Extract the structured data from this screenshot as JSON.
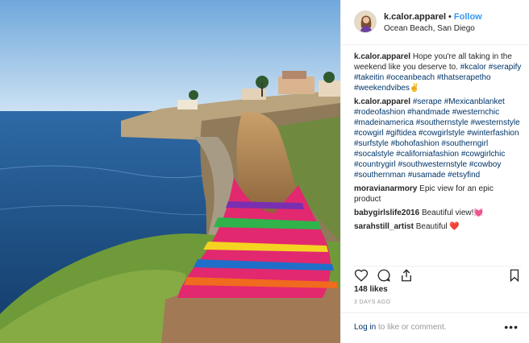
{
  "post": {
    "username": "k.calor.apparel",
    "dot": "•",
    "follow_label": "Follow",
    "location": "Ocean Beach, San Diego"
  },
  "comments": [
    {
      "author": "k.calor.apparel",
      "text": "Hope you're all taking in the weekend like you deserve to. ",
      "tags": "#kcalor #serapify #takeitin #oceanbeach #thatserapetho #weekendvibes✌️"
    },
    {
      "author": "k.calor.apparel",
      "text": "",
      "tags": "#serape #Mexicanblanket #rodeofashion #handmade #westernchic #madeinamerica #southernstyle #westernstyle #cowgirl #giftidea #cowgirlstyle #winterfashion #surfstyle #bohofashion #southerngirl #socalstyle #californiafashion #cowgirlchic #countrygirl #southwesternstyle #cowboy #southernman #usamade #etsyfind"
    },
    {
      "author": "moravianarmory",
      "text": "Epic view for an epic product",
      "tags": ""
    },
    {
      "author": "babygirlslife2016",
      "text": "Beautiful view!💓",
      "tags": ""
    },
    {
      "author": "sarahstill_artist",
      "text": "Beautiful ❤️",
      "tags": ""
    }
  ],
  "stats": {
    "likes": "148 likes",
    "time": "3 DAYS AGO"
  },
  "footer": {
    "login_link": "Log in",
    "login_rest": " to like or comment.",
    "more": "•••"
  },
  "icons": {
    "like": "heart-icon",
    "comment": "comment-icon",
    "share": "share-icon",
    "save": "bookmark-icon"
  },
  "colors": {
    "link": "#003569",
    "follow": "#3897f0",
    "muted": "#999999"
  }
}
